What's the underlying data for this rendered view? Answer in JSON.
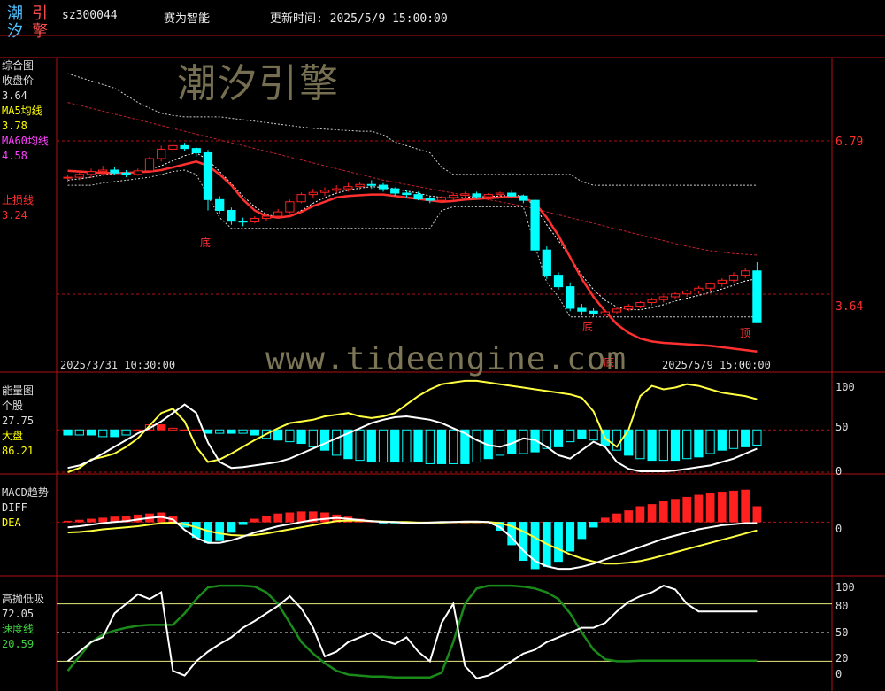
{
  "header": {
    "logo_chars": [
      "潮",
      "引",
      "汐",
      "擎"
    ],
    "code": "sz300044",
    "name": "赛为智能",
    "update_label": "更新时间: 2025/5/9 15:00:00"
  },
  "watermarks": {
    "cn": "潮汐引擎",
    "url": "www.tideengine.com"
  },
  "colors": {
    "background": "#000000",
    "frame": "#b01010",
    "up": "#ff2020",
    "down": "#00ffff",
    "ma60": "#ff3030",
    "yellow_line": "#ffff40",
    "white_line": "#ffffff",
    "green_line": "#1a8a1a",
    "label_yellow": "#ffff00",
    "label_red": "#ff3030",
    "label_green": "#40d040"
  },
  "panels": {
    "main": {
      "title": "综合图",
      "rows": [
        {
          "label": "收盘价",
          "value": "3.64",
          "color": "#dddddd"
        },
        {
          "label": "MA5均线",
          "value": "3.78",
          "color": "#ffff00"
        },
        {
          "label": "MA60均线",
          "value": "4.58",
          "color": "#ff40ff"
        },
        {
          "label": "止损线",
          "value": "3.24",
          "color": "#ff3030"
        }
      ],
      "start_time": "2025/3/31 10:30:00",
      "end_time": "2025/5/9 15:00:00",
      "right_labels": [
        "6.79",
        "3.64"
      ],
      "bottom_markers": [
        "底",
        "底",
        "底"
      ],
      "side_marker": "顶"
    },
    "energy": {
      "title": "能量图",
      "rows": [
        {
          "label": "个股",
          "value": "27.75",
          "color": "#dddddd"
        },
        {
          "label": "大盘",
          "value": "86.21",
          "color": "#ffff00"
        }
      ],
      "axis": [
        "100",
        "50",
        "0"
      ]
    },
    "macd": {
      "title": "MACD趋势",
      "rows": [
        {
          "label": "DIFF",
          "value": "",
          "color": "#dddddd"
        },
        {
          "label": "DEA",
          "value": "",
          "color": "#ffff00"
        }
      ],
      "axis": [
        "0"
      ]
    },
    "osc": {
      "title": "高抛低吸",
      "rows": [
        {
          "label": "",
          "value": "72.05",
          "color": "#dddddd"
        },
        {
          "label": "速度线",
          "value": "20.59",
          "color": "#40d040"
        }
      ],
      "axis": [
        "100",
        "80",
        "50",
        "20",
        "0"
      ]
    }
  },
  "chart_data": {
    "type": "line",
    "price_ylim": [
      3.2,
      7.2
    ],
    "candles": [
      [
        5.65,
        5.7,
        5.6,
        5.66
      ],
      [
        5.66,
        5.74,
        5.62,
        5.7
      ],
      [
        5.7,
        5.78,
        5.65,
        5.74
      ],
      [
        5.74,
        5.82,
        5.7,
        5.76
      ],
      [
        5.76,
        5.8,
        5.7,
        5.72
      ],
      [
        5.72,
        5.76,
        5.66,
        5.7
      ],
      [
        5.7,
        5.78,
        5.68,
        5.75
      ],
      [
        5.75,
        5.95,
        5.72,
        5.92
      ],
      [
        5.92,
        6.1,
        5.88,
        6.05
      ],
      [
        6.05,
        6.14,
        6.0,
        6.1
      ],
      [
        6.1,
        6.14,
        6.02,
        6.06
      ],
      [
        6.06,
        6.08,
        5.95,
        6.0
      ],
      [
        6.0,
        6.04,
        5.2,
        5.35
      ],
      [
        5.35,
        5.4,
        5.15,
        5.2
      ],
      [
        5.2,
        5.24,
        5.0,
        5.05
      ],
      [
        5.05,
        5.1,
        4.98,
        5.04
      ],
      [
        5.04,
        5.12,
        5.02,
        5.09
      ],
      [
        5.09,
        5.16,
        5.05,
        5.12
      ],
      [
        5.12,
        5.22,
        5.1,
        5.18
      ],
      [
        5.18,
        5.35,
        5.16,
        5.32
      ],
      [
        5.32,
        5.45,
        5.3,
        5.42
      ],
      [
        5.42,
        5.5,
        5.38,
        5.45
      ],
      [
        5.45,
        5.52,
        5.4,
        5.48
      ],
      [
        5.48,
        5.55,
        5.44,
        5.5
      ],
      [
        5.5,
        5.58,
        5.46,
        5.53
      ],
      [
        5.53,
        5.6,
        5.48,
        5.56
      ],
      [
        5.56,
        5.62,
        5.5,
        5.55
      ],
      [
        5.55,
        5.58,
        5.46,
        5.5
      ],
      [
        5.5,
        5.52,
        5.4,
        5.44
      ],
      [
        5.44,
        5.48,
        5.38,
        5.42
      ],
      [
        5.42,
        5.46,
        5.34,
        5.36
      ],
      [
        5.36,
        5.4,
        5.3,
        5.34
      ],
      [
        5.34,
        5.4,
        5.3,
        5.38
      ],
      [
        5.38,
        5.44,
        5.34,
        5.41
      ],
      [
        5.41,
        5.46,
        5.36,
        5.43
      ],
      [
        5.43,
        5.46,
        5.36,
        5.39
      ],
      [
        5.39,
        5.44,
        5.34,
        5.42
      ],
      [
        5.42,
        5.46,
        5.38,
        5.44
      ],
      [
        5.44,
        5.48,
        5.38,
        5.4
      ],
      [
        5.4,
        5.42,
        5.3,
        5.34
      ],
      [
        5.34,
        5.36,
        4.6,
        4.65
      ],
      [
        4.65,
        4.7,
        4.25,
        4.3
      ],
      [
        4.3,
        4.34,
        4.1,
        4.14
      ],
      [
        4.14,
        4.2,
        3.8,
        3.84
      ],
      [
        3.84,
        3.9,
        3.74,
        3.8
      ],
      [
        3.8,
        3.84,
        3.72,
        3.76
      ],
      [
        3.76,
        3.82,
        3.73,
        3.79
      ],
      [
        3.79,
        3.86,
        3.76,
        3.83
      ],
      [
        3.83,
        3.9,
        3.8,
        3.87
      ],
      [
        3.87,
        3.94,
        3.84,
        3.92
      ],
      [
        3.92,
        3.99,
        3.88,
        3.96
      ],
      [
        3.96,
        4.02,
        3.92,
        4.0
      ],
      [
        4.0,
        4.06,
        3.96,
        4.04
      ],
      [
        4.04,
        4.1,
        4.0,
        4.08
      ],
      [
        4.08,
        4.15,
        4.04,
        4.12
      ],
      [
        4.12,
        4.2,
        4.08,
        4.18
      ],
      [
        4.18,
        4.26,
        4.14,
        4.23
      ],
      [
        4.23,
        4.34,
        4.2,
        4.3
      ],
      [
        4.3,
        4.4,
        4.26,
        4.36
      ],
      [
        4.36,
        4.48,
        3.64,
        3.64
      ]
    ],
    "ma5": [
      5.62,
      5.64,
      5.66,
      5.69,
      5.71,
      5.72,
      5.73,
      5.77,
      5.82,
      5.89,
      5.96,
      6.0,
      5.9,
      5.74,
      5.57,
      5.4,
      5.25,
      5.15,
      5.1,
      5.12,
      5.2,
      5.3,
      5.38,
      5.44,
      5.48,
      5.51,
      5.53,
      5.52,
      5.5,
      5.47,
      5.44,
      5.4,
      5.38,
      5.37,
      5.38,
      5.39,
      5.39,
      5.4,
      5.41,
      5.4,
      5.25,
      5.0,
      4.78,
      4.55,
      4.3,
      4.1,
      3.95,
      3.86,
      3.82,
      3.82,
      3.85,
      3.89,
      3.94,
      3.98,
      4.02,
      4.06,
      4.11,
      4.16,
      4.22,
      4.25
    ],
    "ma60": [
      6.7,
      6.66,
      6.62,
      6.58,
      6.54,
      6.5,
      6.46,
      6.42,
      6.38,
      6.34,
      6.3,
      6.26,
      6.22,
      6.18,
      6.14,
      6.1,
      6.06,
      6.02,
      5.98,
      5.94,
      5.9,
      5.86,
      5.82,
      5.78,
      5.74,
      5.7,
      5.66,
      5.62,
      5.59,
      5.56,
      5.53,
      5.5,
      5.47,
      5.44,
      5.41,
      5.38,
      5.35,
      5.32,
      5.29,
      5.26,
      5.22,
      5.18,
      5.14,
      5.1,
      5.06,
      5.02,
      4.98,
      4.94,
      4.9,
      4.86,
      4.82,
      4.78,
      4.74,
      4.7,
      4.67,
      4.64,
      4.62,
      4.6,
      4.59,
      4.58
    ],
    "stop_line": [
      5.75,
      5.74,
      5.73,
      5.72,
      5.72,
      5.72,
      5.73,
      5.74,
      5.76,
      5.8,
      5.84,
      5.88,
      5.82,
      5.7,
      5.55,
      5.35,
      5.2,
      5.12,
      5.1,
      5.12,
      5.18,
      5.26,
      5.32,
      5.38,
      5.4,
      5.41,
      5.42,
      5.42,
      5.4,
      5.38,
      5.36,
      5.34,
      5.32,
      5.33,
      5.35,
      5.36,
      5.37,
      5.38,
      5.39,
      5.38,
      5.3,
      5.1,
      4.85,
      4.55,
      4.25,
      4.0,
      3.8,
      3.62,
      3.5,
      3.42,
      3.38,
      3.36,
      3.35,
      3.34,
      3.33,
      3.32,
      3.3,
      3.28,
      3.26,
      3.24
    ],
    "upper_band": [
      7.1,
      7.05,
      7.0,
      6.95,
      6.9,
      6.8,
      6.7,
      6.62,
      6.55,
      6.52,
      6.5,
      6.5,
      6.5,
      6.5,
      6.48,
      6.46,
      6.44,
      6.42,
      6.4,
      6.38,
      6.36,
      6.34,
      6.33,
      6.32,
      6.31,
      6.3,
      6.3,
      6.25,
      6.15,
      6.1,
      6.05,
      6.0,
      5.8,
      5.7,
      5.7,
      5.7,
      5.7,
      5.7,
      5.7,
      5.7,
      5.7,
      5.7,
      5.7,
      5.7,
      5.6,
      5.55,
      5.55,
      5.55,
      5.55,
      5.55,
      5.55,
      5.55,
      5.55,
      5.55,
      5.55,
      5.55,
      5.55,
      5.55,
      5.55,
      5.55
    ],
    "lower_band": [
      5.55,
      5.55,
      5.55,
      5.58,
      5.6,
      5.62,
      5.64,
      5.66,
      5.7,
      5.74,
      5.76,
      5.7,
      5.4,
      5.1,
      4.95,
      4.95,
      4.95,
      4.95,
      4.95,
      4.95,
      4.95,
      4.95,
      4.95,
      4.95,
      4.95,
      4.95,
      4.95,
      4.95,
      4.95,
      4.95,
      4.95,
      4.95,
      5.2,
      5.25,
      5.25,
      5.25,
      5.25,
      5.25,
      5.25,
      5.25,
      4.7,
      4.2,
      4.0,
      3.72,
      3.72,
      3.72,
      3.72,
      3.72,
      3.72,
      3.72,
      3.72,
      3.72,
      3.72,
      3.72,
      3.72,
      3.72,
      3.72,
      3.72,
      3.72,
      3.72
    ],
    "energy_ylim": [
      0,
      110
    ],
    "energy_stock": [
      5,
      8,
      14,
      22,
      30,
      38,
      46,
      52,
      60,
      70,
      80,
      70,
      35,
      12,
      5,
      6,
      8,
      10,
      12,
      16,
      22,
      28,
      34,
      40,
      46,
      52,
      58,
      62,
      65,
      66,
      64,
      62,
      58,
      52,
      46,
      38,
      32,
      30,
      34,
      40,
      38,
      30,
      20,
      16,
      26,
      36,
      30,
      12,
      4,
      1,
      1,
      1,
      2,
      4,
      6,
      8,
      12,
      16,
      22,
      27.75
    ],
    "energy_market": [
      0,
      5,
      15,
      18,
      22,
      30,
      40,
      55,
      70,
      75,
      60,
      30,
      12,
      15,
      22,
      30,
      38,
      45,
      52,
      58,
      60,
      62,
      66,
      68,
      70,
      66,
      64,
      66,
      70,
      80,
      90,
      98,
      104,
      106,
      108,
      108,
      106,
      104,
      102,
      100,
      98,
      96,
      94,
      92,
      88,
      72,
      40,
      30,
      50,
      90,
      102,
      98,
      100,
      104,
      102,
      98,
      94,
      92,
      90,
      86.21
    ],
    "energy_bars": [
      44,
      44,
      44,
      42,
      42,
      44,
      50,
      56,
      56,
      52,
      50,
      50,
      46,
      46,
      46,
      46,
      44,
      40,
      38,
      36,
      34,
      30,
      26,
      20,
      16,
      14,
      12,
      12,
      12,
      12,
      12,
      10,
      10,
      10,
      10,
      12,
      16,
      20,
      22,
      22,
      24,
      28,
      30,
      36,
      40,
      38,
      32,
      26,
      20,
      16,
      14,
      14,
      14,
      16,
      18,
      22,
      26,
      28,
      30,
      32
    ],
    "macd_ylim": [
      -1.0,
      0.5
    ],
    "macd_diff": [
      -0.1,
      -0.08,
      -0.05,
      -0.02,
      0.0,
      0.02,
      0.05,
      0.08,
      0.1,
      0.05,
      -0.15,
      -0.3,
      -0.4,
      -0.4,
      -0.35,
      -0.28,
      -0.2,
      -0.14,
      -0.08,
      -0.04,
      0.0,
      0.04,
      0.06,
      0.08,
      0.06,
      0.04,
      0.02,
      0.0,
      0.0,
      -0.02,
      -0.02,
      -0.01,
      0.0,
      0.0,
      0.01,
      0.01,
      0.0,
      -0.1,
      -0.3,
      -0.55,
      -0.75,
      -0.85,
      -0.9,
      -0.9,
      -0.86,
      -0.8,
      -0.72,
      -0.64,
      -0.56,
      -0.48,
      -0.4,
      -0.32,
      -0.26,
      -0.2,
      -0.14,
      -0.1,
      -0.06,
      -0.04,
      -0.02,
      -0.02
    ],
    "macd_dea": [
      -0.2,
      -0.19,
      -0.17,
      -0.14,
      -0.12,
      -0.1,
      -0.08,
      -0.05,
      -0.02,
      -0.01,
      -0.04,
      -0.1,
      -0.17,
      -0.22,
      -0.25,
      -0.26,
      -0.25,
      -0.22,
      -0.18,
      -0.14,
      -0.1,
      -0.06,
      -0.02,
      0.02,
      0.03,
      0.03,
      0.02,
      0.01,
      0.0,
      0.0,
      -0.01,
      -0.01,
      -0.01,
      0.0,
      0.0,
      0.0,
      0.0,
      -0.02,
      -0.08,
      -0.18,
      -0.3,
      -0.42,
      -0.52,
      -0.62,
      -0.7,
      -0.76,
      -0.8,
      -0.8,
      -0.78,
      -0.75,
      -0.7,
      -0.64,
      -0.58,
      -0.52,
      -0.46,
      -0.4,
      -0.34,
      -0.28,
      -0.22,
      -0.16
    ],
    "macd_hist": [
      0.02,
      0.04,
      0.06,
      0.08,
      0.1,
      0.12,
      0.14,
      0.16,
      0.18,
      0.12,
      -0.1,
      -0.3,
      -0.4,
      -0.36,
      -0.2,
      -0.05,
      0.06,
      0.12,
      0.16,
      0.18,
      0.2,
      0.2,
      0.18,
      0.14,
      0.1,
      0.06,
      0.02,
      -0.02,
      -0.02,
      -0.02,
      -0.02,
      0.0,
      0.0,
      0.0,
      0.0,
      0.0,
      0.0,
      -0.16,
      -0.44,
      -0.74,
      -0.9,
      -0.86,
      -0.76,
      -0.56,
      -0.32,
      -0.1,
      0.08,
      0.16,
      0.22,
      0.3,
      0.34,
      0.4,
      0.44,
      0.48,
      0.52,
      0.56,
      0.58,
      0.6,
      0.62,
      0.3
    ],
    "osc_ylim": [
      0,
      100
    ],
    "osc_white": [
      20,
      30,
      40,
      45,
      70,
      80,
      90,
      85,
      92,
      10,
      5,
      20,
      30,
      38,
      45,
      55,
      62,
      70,
      78,
      88,
      75,
      55,
      25,
      30,
      40,
      45,
      50,
      42,
      38,
      45,
      30,
      20,
      60,
      80,
      15,
      2,
      5,
      12,
      20,
      28,
      32,
      40,
      45,
      50,
      55,
      55,
      60,
      72,
      82,
      88,
      92,
      99,
      95,
      80,
      72.05,
      72.05,
      72.05,
      72.05,
      72.05,
      72.05
    ],
    "osc_green": [
      10,
      25,
      40,
      48,
      52,
      55,
      57,
      58,
      58,
      58,
      70,
      85,
      97,
      99,
      99,
      99,
      98,
      92,
      80,
      60,
      40,
      28,
      18,
      10,
      6,
      5,
      4,
      4,
      3,
      3,
      3,
      3,
      8,
      40,
      80,
      96,
      99,
      99,
      99,
      98,
      96,
      92,
      85,
      70,
      50,
      32,
      22,
      20,
      20,
      20.59,
      20.59,
      20.59,
      20.59,
      20.59,
      20.59,
      20.59,
      20.59,
      20.59,
      20.59,
      20.59
    ]
  }
}
